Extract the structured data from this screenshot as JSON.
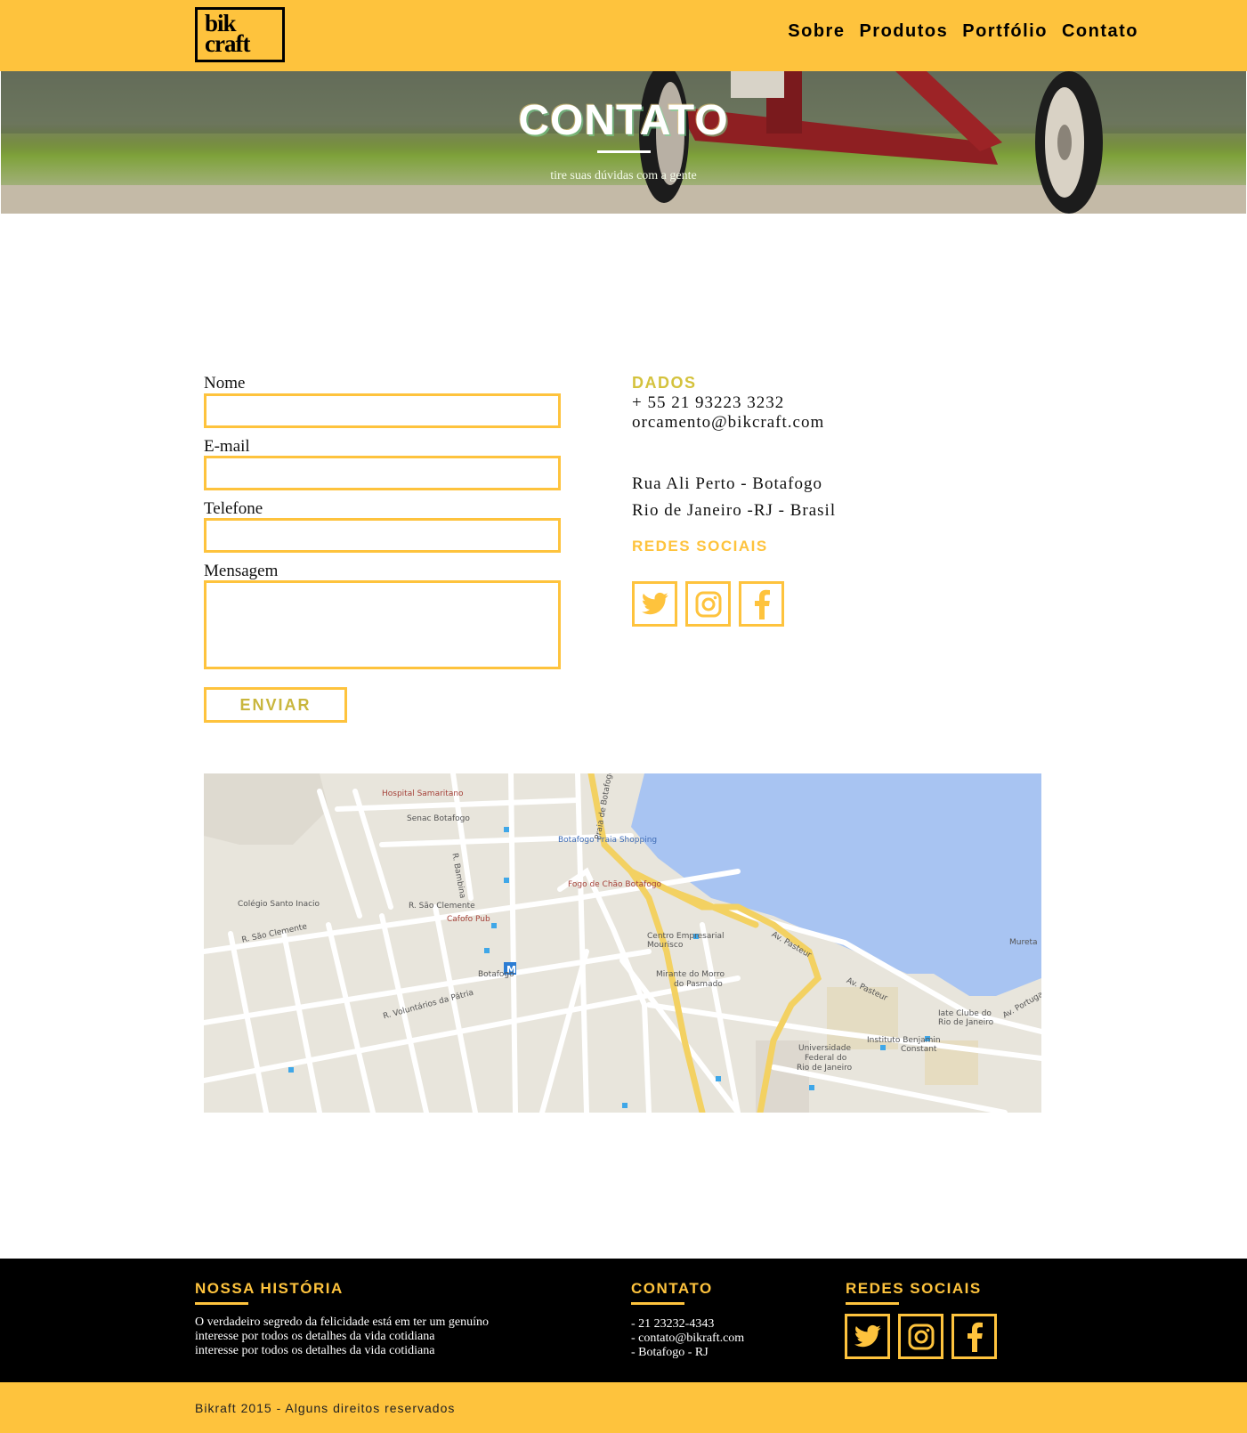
{
  "header": {
    "logo_line1": "bik",
    "logo_line2": "craft",
    "nav": [
      "Sobre",
      "Produtos",
      "Portfólio",
      "Contato"
    ]
  },
  "hero": {
    "title": "CONTATO",
    "subtitle": "tire suas dúvidas com a gente"
  },
  "form": {
    "name_label": "Nome",
    "email_label": "E-mail",
    "phone_label": "Telefone",
    "message_label": "Mensagem",
    "name_value": "",
    "email_value": "",
    "phone_value": "",
    "message_value": "",
    "submit_label": "ENVIAR"
  },
  "contact": {
    "heading": "DADOS",
    "phone": "+ 55 21 93223 3232",
    "email": "orcamento@bikcraft.com",
    "address_line1": "Rua Ali Perto - Botafogo",
    "address_line2": "Rio de Janeiro -RJ - Brasil",
    "social_heading": "REDES SOCIAIS",
    "social_icons": [
      "twitter-icon",
      "instagram-icon",
      "facebook-icon"
    ]
  },
  "map": {
    "labels": {
      "hospital": "Hospital Samaritano",
      "senac": "Senac Botafogo",
      "shopping": "Botafogo Praia Shopping",
      "fogo": "Fogo de Chão Botafogo",
      "colegio": "Colégio Santo Inacio",
      "sao_clemente_1": "R. São Clemente",
      "sao_clemente_2": "R. São Clemente",
      "cafofo": "Cafofo Pub",
      "centro": "Centro Empresarial",
      "mourisco": "Mourisco",
      "botafogo": "Botafogo",
      "mirante": "Mirante do Morro",
      "pasmado": "do Pasmado",
      "pasteur_1": "Av. Pasteur",
      "pasteur_2": "Av. Pasteur",
      "iate_1": "Iate Clube do",
      "iate_2": "Rio de Janeiro",
      "benjamin_1": "Instituto Benjamin",
      "benjamin_2": "Constant",
      "univ_1": "Universidade",
      "univ_2": "Federal do",
      "univ_3": "Rio de Janeiro",
      "voluntarios": "R. Voluntários da Pátria",
      "mureta": "Mureta",
      "portugal": "Av. Portugal",
      "praia_botafogo": "Praia de Botafogo",
      "bambina": "R. Bambina"
    }
  },
  "footer": {
    "history_heading": "NOSSA HISTÓRIA",
    "history_lines": [
      "O verdadeiro segredo da felicidade está em ter um genuíno",
      "interesse por todos os detalhes da vida cotidiana",
      "interesse por todos os detalhes da vida cotidiana"
    ],
    "contact_heading": "CONTATO",
    "contact_lines": [
      "- 21 23232-4343",
      "- contato@bikraft.com",
      "- Botafogo - RJ"
    ],
    "social_heading": "REDES SOCIAIS",
    "copyright": "Bikraft 2015 - Alguns direitos reservados"
  },
  "colors": {
    "brand_yellow": "#fec33d",
    "footer_bg": "#000000",
    "water": "#a8c4f2"
  }
}
